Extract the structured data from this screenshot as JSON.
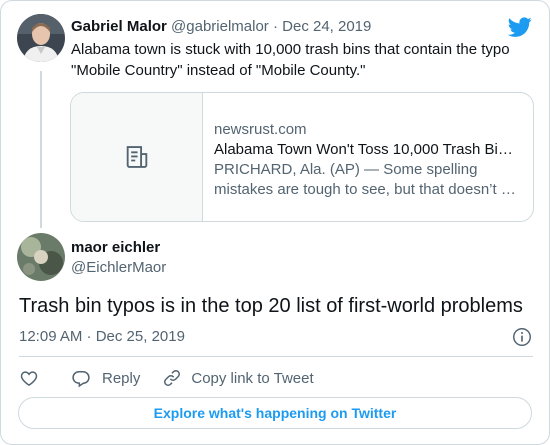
{
  "parent_tweet": {
    "author_name": "Gabriel Malor",
    "author_handle": "@gabrielmalor",
    "separator": "·",
    "date": "Dec 24, 2019",
    "text": "Alabama town is stuck with 10,000 trash bins that contain the typo \"Mobile Country\" instead of \"Mobile County.\"",
    "link_card": {
      "domain": "newsrust.com",
      "title": "Alabama Town Won't Toss 10,000 Trash Bi…",
      "description_line1": "PRICHARD, Ala. (AP) — Some spelling",
      "description_line2": "mistakes are tough to see, but that doesn’t …",
      "thumbnail_icon": "article-icon"
    }
  },
  "reply_tweet": {
    "author_name": "maor eichler",
    "author_handle": "@EichlerMaor",
    "text": "Trash bin typos is in the top 20 list of first-world problems",
    "timestamp": "12:09 AM · Dec 25, 2019"
  },
  "actions": {
    "like_icon": "heart-icon",
    "reply_label": "Reply",
    "copy_link_label": "Copy link to Tweet"
  },
  "explore_button_label": "Explore what's happening on Twitter",
  "colors": {
    "accent": "#1d9bf0",
    "text": "#0f1419",
    "muted": "#536471",
    "border": "#cfd9de"
  }
}
